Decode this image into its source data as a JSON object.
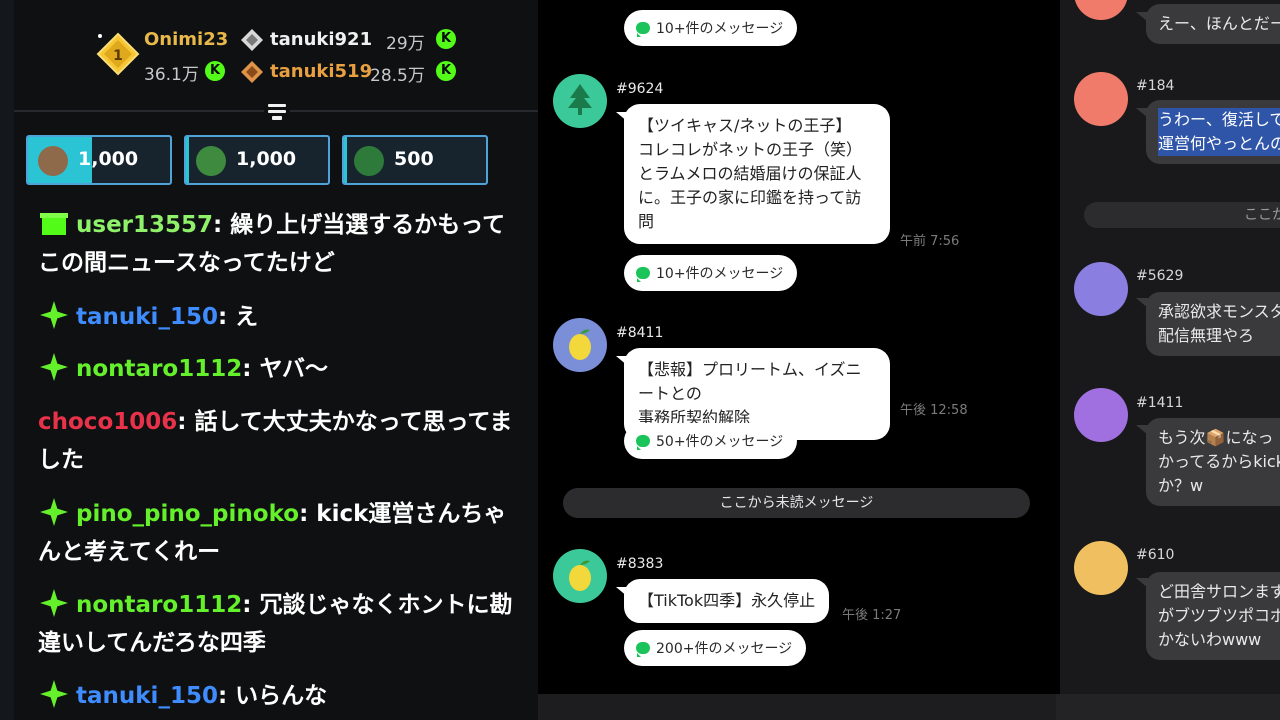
{
  "kick_chat": {
    "leaderboard": [
      {
        "name": "Onimi23",
        "amount": "36.1万",
        "rank": "1",
        "name_color": "#e8b84a"
      },
      {
        "name": "tanuki921",
        "amount": "29万",
        "name_color": "#f0f0f0"
      },
      {
        "name": "tanuki519",
        "amount": "28.5万",
        "name_color": "#e8a040"
      }
    ],
    "coin_symbol": "K",
    "gifts": [
      {
        "value": "1,000",
        "progress": 0.45
      },
      {
        "value": "1,000",
        "progress": 0.02
      },
      {
        "value": "500",
        "progress": 0.02
      }
    ],
    "messages": [
      {
        "user": "user13557",
        "text": ": 繰り上げ当選するかもってこの間ニュースなってたけど",
        "user_color": "#8ff06a",
        "badge": "gift-icon"
      },
      {
        "user": "tanuki_150",
        "text": ": え",
        "user_color": "#3f8cff",
        "badge": "sparkle-icon"
      },
      {
        "user": "nontaro1112",
        "text": ": ヤバ〜",
        "user_color": "#65f02c",
        "badge": "sparkle-icon"
      },
      {
        "user": "choco1006",
        "text": ": 話して大丈夫かなって思ってました",
        "user_color": "#e8324a",
        "badge": ""
      },
      {
        "user": "pino_pino_pinoko",
        "text": ": kick運営さんちゃんと考えてくれー",
        "user_color": "#65f02c",
        "badge": "sparkle-icon"
      },
      {
        "user": "nontaro1112",
        "text": ": 冗談じゃなくホントに勘違いしてんだろな四季",
        "user_color": "#65f02c",
        "badge": "sparkle-icon"
      },
      {
        "user": "tanuki_150",
        "text": ": いらんな",
        "user_color": "#3f8cff",
        "badge": "sparkle-icon"
      }
    ]
  },
  "line_list": {
    "top_pill": "10+件のメッセージ",
    "rooms": [
      {
        "id": "#9624",
        "lines": [
          "【ツイキャス/ネットの王子】",
          "コレコレがネットの王子（笑）",
          "とラムメロの結婚届けの保証人",
          "に。王子の家に印鑑を持って訪",
          "問"
        ],
        "time": "午前 7:56",
        "pill": "10+件のメッセージ",
        "avatar_color": "#3cc99a"
      },
      {
        "id": "#8411",
        "lines": [
          "【悲報】プロリートム、イズニートとの",
          "事務所契約解除"
        ],
        "time": "午後 12:58",
        "pill": "50+件のメッセージ",
        "avatar_color": "#7b8ed8"
      },
      {
        "id": "#8383",
        "lines": [
          "【TikTok四季】永久停止"
        ],
        "time": "午後 1:27",
        "pill": "200+件のメッセージ",
        "avatar_color": "#3cc99a"
      }
    ],
    "unread_divider": "ここから未読メッセージ"
  },
  "line_chat": {
    "top_text": "えー、ほんとだー",
    "divider": "ここか",
    "messages": [
      {
        "id": "#184",
        "lines": [
          "うわー、復活してる",
          "運営何やっとんの"
        ],
        "highlighted": true,
        "avatar_color": "#f07b6a"
      },
      {
        "id": "#5629",
        "lines": [
          "承認欲求モンスタ",
          "配信無理やろ"
        ],
        "highlighted": false,
        "avatar_color": "#8a7fe0"
      },
      {
        "id": "#1411",
        "lines": [
          "もう次📦になっ",
          "かってるからkickラ",
          "か？w"
        ],
        "highlighted": false,
        "avatar_color": "#a070e0"
      },
      {
        "id": "#610",
        "lines": [
          "ど田舎サロンまず",
          "がブツブツポコポコ",
          "かないわwww"
        ],
        "highlighted": false,
        "avatar_color": "#f0c060"
      }
    ]
  }
}
